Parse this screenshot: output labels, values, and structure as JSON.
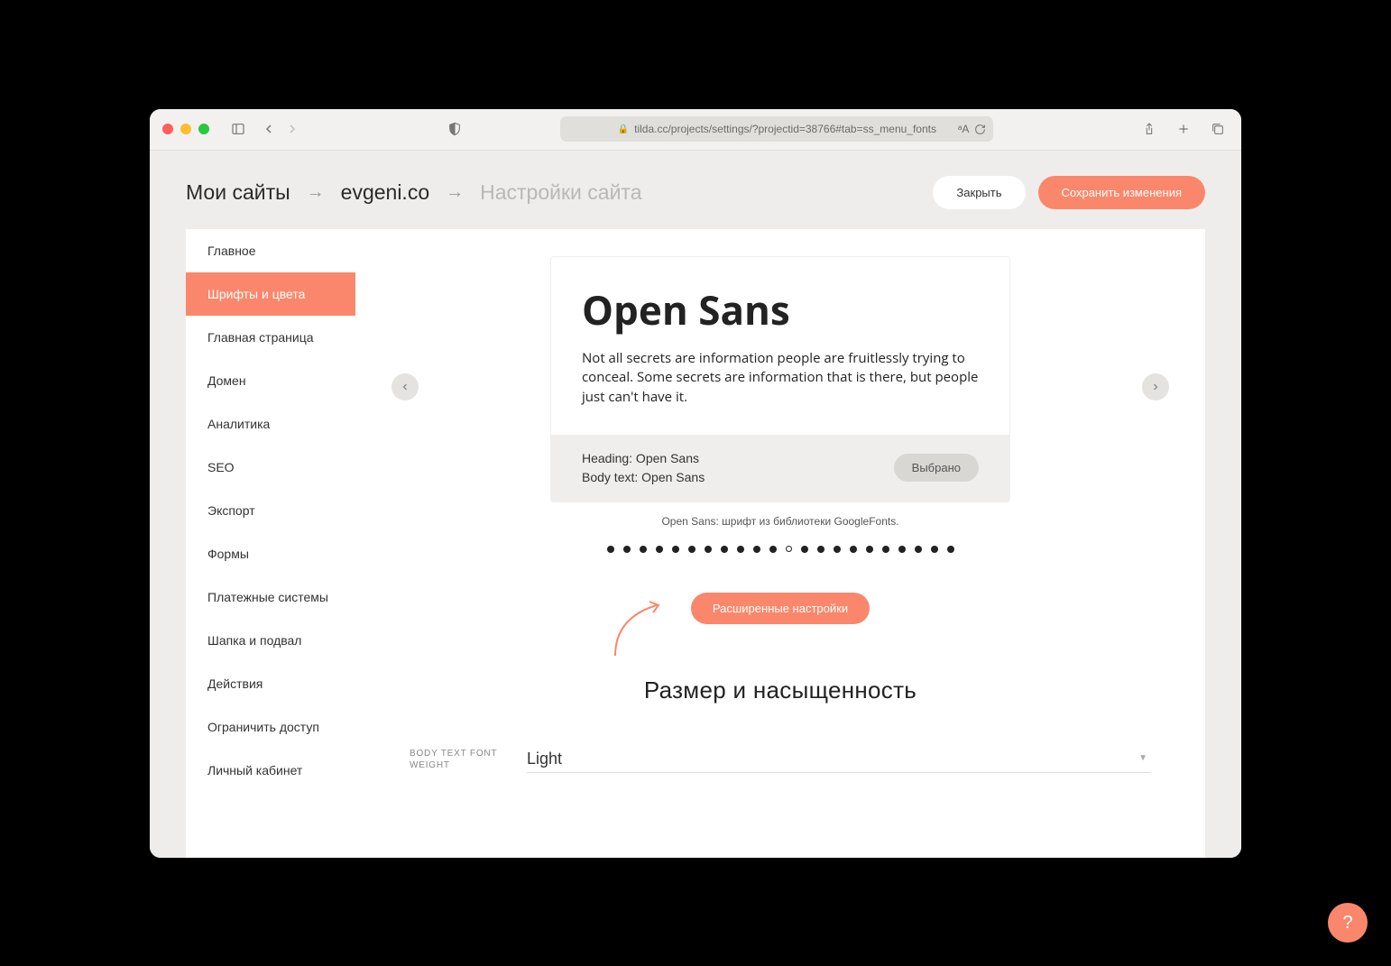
{
  "browser": {
    "url": "tilda.cc/projects/settings/?projectid=38766#tab=ss_menu_fonts"
  },
  "breadcrumbs": {
    "item1": "Мои сайты",
    "item2": "evgeni.co",
    "item3": "Настройки сайта",
    "arrow": "→"
  },
  "header": {
    "close": "Закрыть",
    "save": "Сохранить изменения"
  },
  "sidebar": {
    "items": [
      "Главное",
      "Шрифты и цвета",
      "Главная страница",
      "Домен",
      "Аналитика",
      "SEO",
      "Экспорт",
      "Формы",
      "Платежные системы",
      "Шапка и подвал",
      "Действия",
      "Ограничить доступ",
      "Личный кабинет"
    ],
    "activeIndex": 1
  },
  "fontCard": {
    "title": "Open Sans",
    "sample": "Not all secrets are information people are fruitlessly trying to conceal. Some secrets are information that is there, but people just can't have it.",
    "heading_line": "Heading: Open Sans",
    "body_line": "Body text: Open Sans",
    "chip": "Выбрано",
    "caption": "Open Sans: шрифт из библиотеки GoogleFonts."
  },
  "dots": {
    "total": 22,
    "hollowIndex": 11
  },
  "advanced_button": "Расширенные настройки",
  "section_title": "Размер и насыщенность",
  "field": {
    "label": "BODY TEXT FONT WEIGHT",
    "value": "Light"
  },
  "help": "?"
}
